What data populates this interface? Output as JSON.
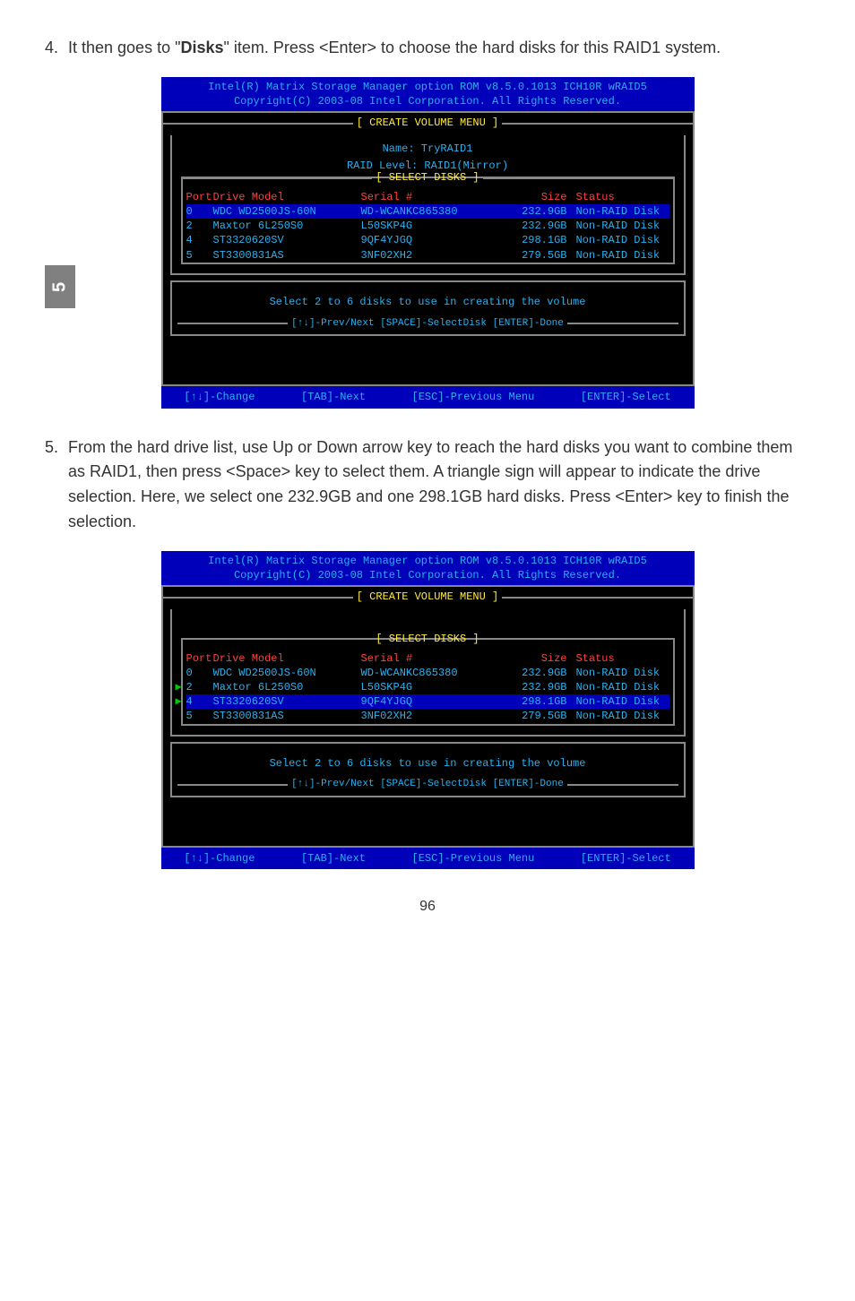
{
  "steps": {
    "s4_num": "4.",
    "s4_text_a": "It then goes to \"",
    "s4_bold": "Disks",
    "s4_text_b": "\" item. Press <Enter> to choose the hard disks for this RAID1 system.",
    "s5_num": "5.",
    "s5_text": "From the hard drive list, use Up or Down arrow key to reach the hard disks you want to combine them as RAID1, then press <Space> key to select them. A triangle sign will appear to indicate the drive selection. Here, we select one 232.9GB and one 298.1GB hard disks. Press <Enter> key to finish the selection."
  },
  "sidebar": {
    "chapter": "5"
  },
  "bios": {
    "header_l1": "Intel(R) Matrix Storage Manager option ROM v8.5.0.1013 ICH10R wRAID5",
    "header_l2": "Copyright(C) 2003-08 Intel Corporation.   All Rights Reserved.",
    "title_menu": "[ CREATE VOLUME MENU ]",
    "name_line": "Name:  TryRAID1",
    "raid_line": "RAID Level:  RAID1(Mirror)",
    "title_disks": "[ SELECT DISKS ]",
    "cols": {
      "port": "Port",
      "model": "Drive Model",
      "serial": "Serial #",
      "size": "Size",
      "status": "Status"
    },
    "rows": [
      {
        "port": "0",
        "model": "WDC WD2500JS-60N",
        "serial": "WD-WCANKC865380",
        "size": "232.9GB",
        "status": "Non-RAID Disk"
      },
      {
        "port": "2",
        "model": "Maxtor 6L250S0",
        "serial": "L50SKP4G",
        "size": "232.9GB",
        "status": "Non-RAID Disk"
      },
      {
        "port": "4",
        "model": "ST3320620SV",
        "serial": "9QF4YJGQ",
        "size": "298.1GB",
        "status": "Non-RAID Disk"
      },
      {
        "port": "5",
        "model": "ST3300831AS",
        "serial": "3NF02XH2",
        "size": "279.5GB",
        "status": "Non-RAID Disk"
      }
    ],
    "select_msg": "Select 2 to 6 disks to use in creating the volume",
    "nav_msg": "[↑↓]-Prev/Next [SPACE]-SelectDisk [ENTER]-Done",
    "footer": {
      "a": "[↑↓]-Change",
      "b": "[TAB]-Next",
      "c": "[ESC]-Previous Menu",
      "d": "[ENTER]-Select"
    }
  },
  "page_number": "96"
}
